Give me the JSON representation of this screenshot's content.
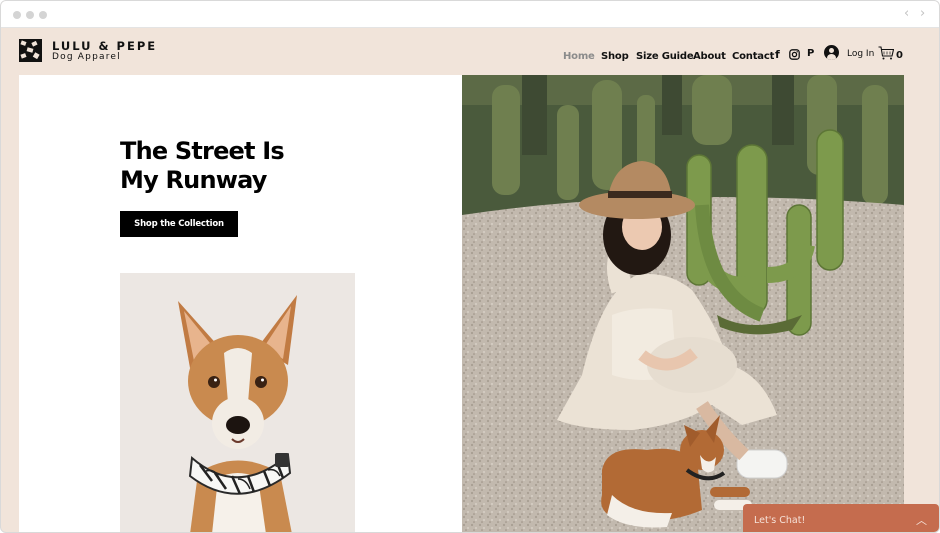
{
  "browser": {
    "back_icon": "chevron-left-icon",
    "forward_icon": "chevron-right-icon"
  },
  "brand": {
    "name": "LULU & PEPE",
    "tagline": "Dog Apparel",
    "logo_icon": "checker-logo-icon"
  },
  "nav": {
    "items": [
      {
        "label": "Home",
        "active": true
      },
      {
        "label": "Shop"
      },
      {
        "label": "Size Guide"
      },
      {
        "label": "About"
      },
      {
        "label": "Contact"
      }
    ],
    "social": {
      "facebook": "f",
      "instagram_icon": "instagram-icon",
      "pinterest": "P"
    },
    "login_label": "Log In",
    "cart_count": "0"
  },
  "hero": {
    "headline_line1": "The Street Is",
    "headline_line2": "My Runway",
    "cta_label": "Shop the Collection"
  },
  "chat": {
    "label": "Let's Chat!"
  },
  "colors": {
    "header_bg": "#f1e4da",
    "chat_bg": "#c56c4e",
    "button_bg": "#000000"
  }
}
